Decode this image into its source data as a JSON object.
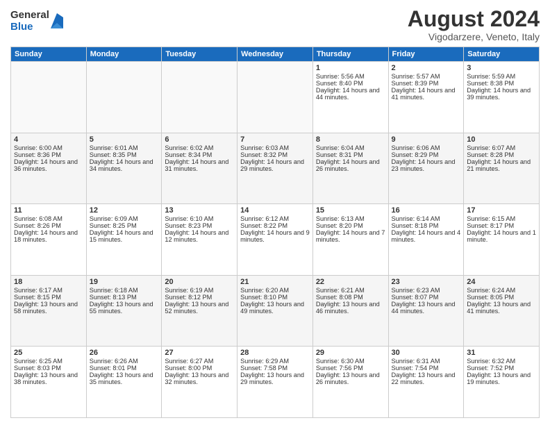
{
  "logo": {
    "general": "General",
    "blue": "Blue"
  },
  "title": "August 2024",
  "subtitle": "Vigodarzere, Veneto, Italy",
  "headers": [
    "Sunday",
    "Monday",
    "Tuesday",
    "Wednesday",
    "Thursday",
    "Friday",
    "Saturday"
  ],
  "weeks": [
    [
      {
        "day": "",
        "sunrise": "",
        "sunset": "",
        "daylight": ""
      },
      {
        "day": "",
        "sunrise": "",
        "sunset": "",
        "daylight": ""
      },
      {
        "day": "",
        "sunrise": "",
        "sunset": "",
        "daylight": ""
      },
      {
        "day": "",
        "sunrise": "",
        "sunset": "",
        "daylight": ""
      },
      {
        "day": "1",
        "sunrise": "Sunrise: 5:56 AM",
        "sunset": "Sunset: 8:40 PM",
        "daylight": "Daylight: 14 hours and 44 minutes."
      },
      {
        "day": "2",
        "sunrise": "Sunrise: 5:57 AM",
        "sunset": "Sunset: 8:39 PM",
        "daylight": "Daylight: 14 hours and 41 minutes."
      },
      {
        "day": "3",
        "sunrise": "Sunrise: 5:59 AM",
        "sunset": "Sunset: 8:38 PM",
        "daylight": "Daylight: 14 hours and 39 minutes."
      }
    ],
    [
      {
        "day": "4",
        "sunrise": "Sunrise: 6:00 AM",
        "sunset": "Sunset: 8:36 PM",
        "daylight": "Daylight: 14 hours and 36 minutes."
      },
      {
        "day": "5",
        "sunrise": "Sunrise: 6:01 AM",
        "sunset": "Sunset: 8:35 PM",
        "daylight": "Daylight: 14 hours and 34 minutes."
      },
      {
        "day": "6",
        "sunrise": "Sunrise: 6:02 AM",
        "sunset": "Sunset: 8:34 PM",
        "daylight": "Daylight: 14 hours and 31 minutes."
      },
      {
        "day": "7",
        "sunrise": "Sunrise: 6:03 AM",
        "sunset": "Sunset: 8:32 PM",
        "daylight": "Daylight: 14 hours and 29 minutes."
      },
      {
        "day": "8",
        "sunrise": "Sunrise: 6:04 AM",
        "sunset": "Sunset: 8:31 PM",
        "daylight": "Daylight: 14 hours and 26 minutes."
      },
      {
        "day": "9",
        "sunrise": "Sunrise: 6:06 AM",
        "sunset": "Sunset: 8:29 PM",
        "daylight": "Daylight: 14 hours and 23 minutes."
      },
      {
        "day": "10",
        "sunrise": "Sunrise: 6:07 AM",
        "sunset": "Sunset: 8:28 PM",
        "daylight": "Daylight: 14 hours and 21 minutes."
      }
    ],
    [
      {
        "day": "11",
        "sunrise": "Sunrise: 6:08 AM",
        "sunset": "Sunset: 8:26 PM",
        "daylight": "Daylight: 14 hours and 18 minutes."
      },
      {
        "day": "12",
        "sunrise": "Sunrise: 6:09 AM",
        "sunset": "Sunset: 8:25 PM",
        "daylight": "Daylight: 14 hours and 15 minutes."
      },
      {
        "day": "13",
        "sunrise": "Sunrise: 6:10 AM",
        "sunset": "Sunset: 8:23 PM",
        "daylight": "Daylight: 14 hours and 12 minutes."
      },
      {
        "day": "14",
        "sunrise": "Sunrise: 6:12 AM",
        "sunset": "Sunset: 8:22 PM",
        "daylight": "Daylight: 14 hours and 9 minutes."
      },
      {
        "day": "15",
        "sunrise": "Sunrise: 6:13 AM",
        "sunset": "Sunset: 8:20 PM",
        "daylight": "Daylight: 14 hours and 7 minutes."
      },
      {
        "day": "16",
        "sunrise": "Sunrise: 6:14 AM",
        "sunset": "Sunset: 8:18 PM",
        "daylight": "Daylight: 14 hours and 4 minutes."
      },
      {
        "day": "17",
        "sunrise": "Sunrise: 6:15 AM",
        "sunset": "Sunset: 8:17 PM",
        "daylight": "Daylight: 14 hours and 1 minute."
      }
    ],
    [
      {
        "day": "18",
        "sunrise": "Sunrise: 6:17 AM",
        "sunset": "Sunset: 8:15 PM",
        "daylight": "Daylight: 13 hours and 58 minutes."
      },
      {
        "day": "19",
        "sunrise": "Sunrise: 6:18 AM",
        "sunset": "Sunset: 8:13 PM",
        "daylight": "Daylight: 13 hours and 55 minutes."
      },
      {
        "day": "20",
        "sunrise": "Sunrise: 6:19 AM",
        "sunset": "Sunset: 8:12 PM",
        "daylight": "Daylight: 13 hours and 52 minutes."
      },
      {
        "day": "21",
        "sunrise": "Sunrise: 6:20 AM",
        "sunset": "Sunset: 8:10 PM",
        "daylight": "Daylight: 13 hours and 49 minutes."
      },
      {
        "day": "22",
        "sunrise": "Sunrise: 6:21 AM",
        "sunset": "Sunset: 8:08 PM",
        "daylight": "Daylight: 13 hours and 46 minutes."
      },
      {
        "day": "23",
        "sunrise": "Sunrise: 6:23 AM",
        "sunset": "Sunset: 8:07 PM",
        "daylight": "Daylight: 13 hours and 44 minutes."
      },
      {
        "day": "24",
        "sunrise": "Sunrise: 6:24 AM",
        "sunset": "Sunset: 8:05 PM",
        "daylight": "Daylight: 13 hours and 41 minutes."
      }
    ],
    [
      {
        "day": "25",
        "sunrise": "Sunrise: 6:25 AM",
        "sunset": "Sunset: 8:03 PM",
        "daylight": "Daylight: 13 hours and 38 minutes."
      },
      {
        "day": "26",
        "sunrise": "Sunrise: 6:26 AM",
        "sunset": "Sunset: 8:01 PM",
        "daylight": "Daylight: 13 hours and 35 minutes."
      },
      {
        "day": "27",
        "sunrise": "Sunrise: 6:27 AM",
        "sunset": "Sunset: 8:00 PM",
        "daylight": "Daylight: 13 hours and 32 minutes."
      },
      {
        "day": "28",
        "sunrise": "Sunrise: 6:29 AM",
        "sunset": "Sunset: 7:58 PM",
        "daylight": "Daylight: 13 hours and 29 minutes."
      },
      {
        "day": "29",
        "sunrise": "Sunrise: 6:30 AM",
        "sunset": "Sunset: 7:56 PM",
        "daylight": "Daylight: 13 hours and 26 minutes."
      },
      {
        "day": "30",
        "sunrise": "Sunrise: 6:31 AM",
        "sunset": "Sunset: 7:54 PM",
        "daylight": "Daylight: 13 hours and 22 minutes."
      },
      {
        "day": "31",
        "sunrise": "Sunrise: 6:32 AM",
        "sunset": "Sunset: 7:52 PM",
        "daylight": "Daylight: 13 hours and 19 minutes."
      }
    ]
  ]
}
